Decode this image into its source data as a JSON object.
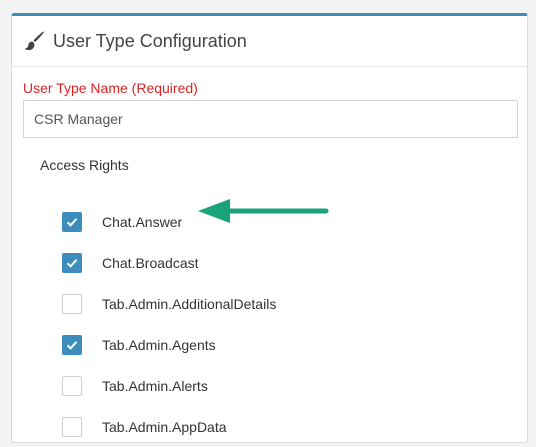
{
  "panel": {
    "title": "User Type Configuration",
    "icon": "paint-brush-icon",
    "accent_color": "#3c8dbc"
  },
  "form": {
    "user_type_name_label": "User Type Name (Required)",
    "user_type_name_value": "CSR Manager",
    "label_color": "#dd2222"
  },
  "access_rights": {
    "label": "Access Rights",
    "items": [
      {
        "label": "Chat.Answer",
        "checked": true
      },
      {
        "label": "Chat.Broadcast",
        "checked": true
      },
      {
        "label": "Tab.Admin.AdditionalDetails",
        "checked": false
      },
      {
        "label": "Tab.Admin.Agents",
        "checked": true
      },
      {
        "label": "Tab.Admin.Alerts",
        "checked": false
      },
      {
        "label": "Tab.Admin.AppData",
        "checked": false
      }
    ]
  },
  "annotation": {
    "icon": "arrow-left-icon",
    "color": "#1aa37a"
  }
}
